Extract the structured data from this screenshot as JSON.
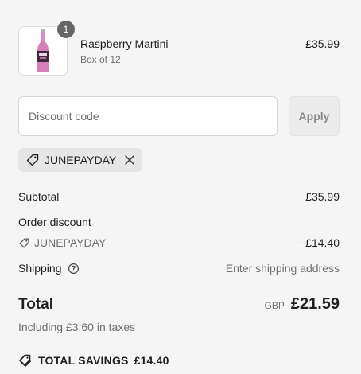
{
  "product": {
    "quantity": "1",
    "name": "Raspberry Martini",
    "variant": "Box of 12",
    "price": "£35.99",
    "image_icon": "pink-bottle-image"
  },
  "discount": {
    "placeholder": "Discount code",
    "value": "",
    "apply_label": "Apply",
    "applied_code": "JUNEPAYDAY"
  },
  "summary": {
    "subtotal_label": "Subtotal",
    "subtotal_value": "£35.99",
    "order_discount_label": "Order discount",
    "discount_code": "JUNEPAYDAY",
    "discount_value": "− £14.40",
    "shipping_label": "Shipping",
    "shipping_value": "Enter shipping address",
    "total_label": "Total",
    "currency": "GBP",
    "total_value": "£21.59",
    "taxes_note": "Including £3.60 in taxes",
    "savings_label": "TOTAL SAVINGS",
    "savings_value": "£14.40"
  },
  "colors": {
    "background": "#f5f5f5",
    "text": "#1f1f1f",
    "muted": "#707070",
    "badge": "#666666"
  }
}
